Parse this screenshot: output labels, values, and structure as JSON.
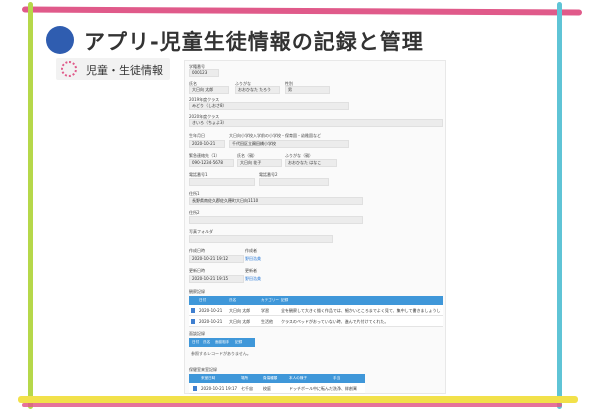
{
  "title": "アプリ-児童生徒情報の記録と管理",
  "subtitle": "児童・生徒情報",
  "form": {
    "student_no_label": "学籍番号",
    "student_no": "000123",
    "name_label": "氏名",
    "name": "大日向 太郎",
    "kana_label": "ふりがな",
    "kana": "おおひなた たろう",
    "gender_label": "性別",
    "gender": "男",
    "class2019_label": "2019年度クラス",
    "class2019": "みどり（しおさ8）",
    "class2020_label": "2020年度クラス",
    "class2020": "きいろ（ちょよ3）",
    "birth_label": "生年月日",
    "birth": "2020-10-21",
    "school_label": "大日向小学校入学前の小学校・保育園・幼稚園など",
    "school": "千代田区立麹田橋小学校",
    "emergency_label": "緊急連絡先（1）",
    "emergency": "090-1234-5678",
    "guardian_label": "氏名（親）",
    "guardian": "大日向 花子",
    "guardian_kana_label": "ふりがな（親）",
    "guardian_kana": "おおひなた はなこ",
    "phone1_label": "電話番号1",
    "phone2_label": "電話番号2",
    "address1_label": "住所1",
    "address1": "長野県南佐久郡佐久穂町大日向1110",
    "address2_label": "住所2",
    "photo_label": "写真フォルダ",
    "created_label": "作成日時",
    "created": "2020-10-21 19:12",
    "creator_label": "作成者",
    "creator": "野田浩美",
    "updated_label": "更新日時",
    "updated": "2020-10-21 19:15",
    "updater_label": "更新者",
    "updater": "野田浩美"
  },
  "observation": {
    "label": "観察記録",
    "headers": [
      "日付",
      "氏名",
      "カテゴリー",
      "記録"
    ],
    "rows": [
      [
        "2020-10-21",
        "大日向 太郎",
        "学習",
        "全を観察して大きく描く作品では、細かいところまでよく見て、集中して書きましょうした。"
      ],
      [
        "2020-10-21",
        "大日向 太郎",
        "生活他",
        "クラスのペッドがおっていない時、進んで片付けてくれた。"
      ]
    ]
  },
  "interview": {
    "label": "面談記録",
    "headers": [
      "日付",
      "氏名",
      "面談相手",
      "記録"
    ],
    "empty": "参照するレコードがありません。"
  },
  "health": {
    "label": "保健室来室記録",
    "headers": [
      "来室日時",
      "場所",
      "負傷種類",
      "本人の様子",
      "手当"
    ],
    "rows": [
      [
        "2020-10-21  19:17",
        "七千宙",
        "校庭",
        "ドッチボール中に転んだ",
        "洗浄、絆創膏"
      ]
    ]
  }
}
